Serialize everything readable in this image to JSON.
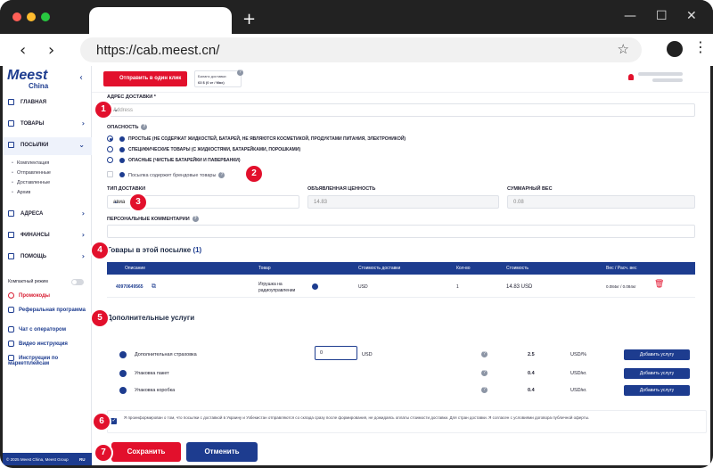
{
  "browser": {
    "url": "https://cab.meest.cn/",
    "new_tab_glyph": "+",
    "controls": {
      "minimize": "—",
      "maximize": "☐",
      "close": "✕"
    },
    "nav": {
      "back": "‹",
      "forward": "›"
    }
  },
  "brand": {
    "logo": "Meest",
    "sub": "China",
    "primary_color": "#1d3c8f",
    "accent_color": "#e2102c"
  },
  "sidebar": {
    "items": [
      {
        "label": "ГЛАВНАЯ",
        "icon": "grid-icon"
      },
      {
        "label": "ТОВАРЫ",
        "icon": "box-icon"
      },
      {
        "label": "ПОСЫЛКИ",
        "icon": "parcel-icon"
      },
      {
        "label": "АДРЕСА",
        "icon": "pin-icon"
      },
      {
        "label": "ФИНАНСЫ",
        "icon": "wallet-icon"
      },
      {
        "label": "ПОМОЩЬ",
        "icon": "help-icon"
      }
    ],
    "parcels_sub": [
      "Комплектация",
      "Отправленные",
      "Доставленные",
      "Архив"
    ],
    "compact_mode": "Компактный режим",
    "links": [
      "Промокоды",
      "Реферальная программа",
      "Чат с оператором",
      "Видео инструкция",
      "Инструкции по маркетплейсам"
    ],
    "footer": "© 2025 Meest China, Meest Group",
    "lang": "RU"
  },
  "topbar": {
    "send_button": "Отправить в один клик",
    "balance_label": "Баланс доставки:",
    "balance_value": "63 $ (0 кг / Max)"
  },
  "form": {
    "address_label": "АДРЕС ДОСТАВКИ *",
    "address_placeholder": "Address",
    "danger_label": "ОПАСНОСТЬ",
    "danger_options": [
      "ПРОСТЫЕ (НЕ СОДЕРЖАТ ЖИДКОСТЕЙ, БАТАРЕЙ, НЕ ЯВЛЯЮТСЯ КОСМЕТИКОЙ, ПРОДУКТАМИ ПИТАНИЯ, ЭЛЕКТРОНИКОЙ)",
      "СПЕЦИФИЧЕСКИЕ ТОВАРЫ (С ЖИДКОСТЯМИ, БАТАРЕЙКАМИ, ПОРОШКАМИ)",
      "ОПАСНЫЕ (ЧИСТЫЕ БАТАРЕЙКИ И ПАВЕРБАНКИ)"
    ],
    "branded_label": "Посылка содержит брендовые товары",
    "delivery_type_label": "ТИП ДОСТАВКИ",
    "delivery_type_value": "авиа",
    "declared_value_label": "ОБЪЯВЛЕННАЯ ЦЕННОСТЬ",
    "declared_value": "14.83",
    "total_weight_label": "СУММАРНЫЙ ВЕС",
    "total_weight": "0.08",
    "comments_label": "ПЕРСОНАЛЬНЫЕ КОММЕНТАРИИ"
  },
  "goods": {
    "title": "Товары в этой посылке",
    "count": "(1)",
    "columns": [
      "Описание",
      "Товар",
      "Стоимость доставки",
      "Кол-во",
      "Стоимость",
      "Вес / Расч. вес"
    ],
    "rows": [
      {
        "id": "40970649565",
        "product": "Игрушка на радиоуправлении",
        "currency": "USD",
        "qty": "1",
        "cost": "14.83 USD",
        "weight": "0.084кг / 0.084кг"
      }
    ]
  },
  "services": {
    "title": "Дополнительные услуги",
    "items": [
      {
        "name": "Дополнительная страховка",
        "input": "0",
        "input_unit": "USD",
        "price": "2.5",
        "unit": "USD/%",
        "button": "Добавить услугу"
      },
      {
        "name": "Упаковка пакет",
        "price": "0.4",
        "unit": "USD/кг.",
        "button": "Добавить услугу"
      },
      {
        "name": "Упаковка коробка",
        "price": "0.4",
        "unit": "USD/кг.",
        "button": "Добавить услугу"
      }
    ]
  },
  "agreement": "Я проинформирован о том, что посылки с доставкой в Украину и Узбекистан отправляются со склада сразу после формирования, не дожидаясь оплаты стоимости доставки. Для стран доставки. Я согласен с условиями договора публичной оферты.",
  "actions": {
    "save": "Сохранить",
    "cancel": "Отменить"
  },
  "badges": [
    "1",
    "2",
    "3",
    "4",
    "5",
    "6",
    "7"
  ]
}
